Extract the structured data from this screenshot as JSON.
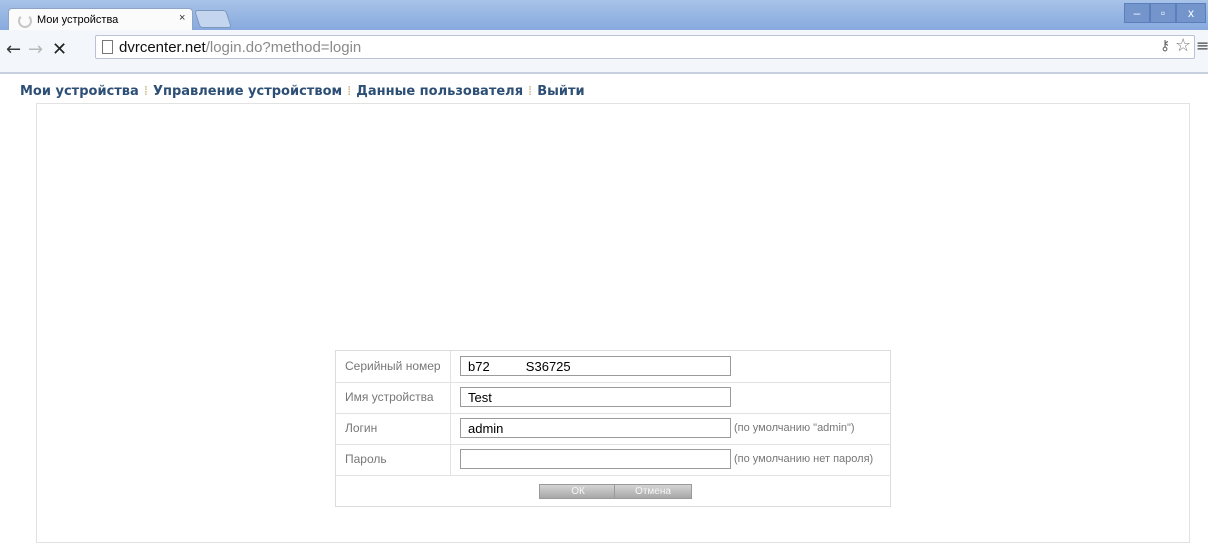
{
  "browser": {
    "tab_title": "Мои устройства",
    "tab_close": "×",
    "url_host": "dvrcenter.net",
    "url_path": "/login.do?method=login",
    "nav_back": "←",
    "nav_forward": "→",
    "nav_stop": "✕",
    "win_minimize": "–",
    "win_maximize": "▫",
    "win_close": "x",
    "icons": [
      "back-arrow-icon",
      "forward-arrow-icon",
      "stop-icon",
      "page-icon",
      "key-icon",
      "star-icon",
      "menu-icon"
    ]
  },
  "nav": {
    "items": [
      "Мои устройства",
      "Управление устройством",
      "Данные пользователя",
      "Выйти"
    ]
  },
  "form": {
    "serial_label": "Серийный номер",
    "serial_value": "b72          S36725",
    "device_label": "Имя устройства",
    "device_value": "Test",
    "login_label": "Логин",
    "login_value": "admin",
    "login_hint": "(по умолчанию \"admin\")",
    "password_label": "Пароль",
    "password_value": "",
    "password_hint": "(по умолчанию нет пароля)",
    "ok_label": "ОК",
    "cancel_label": "Отмена"
  },
  "colors": {
    "nav_link": "#2d4f76",
    "titlebar": "#86a9de"
  }
}
